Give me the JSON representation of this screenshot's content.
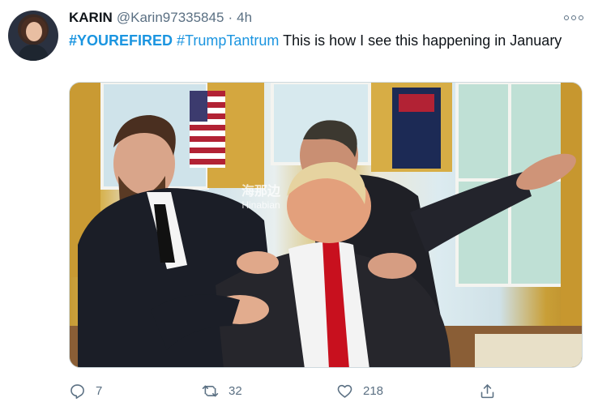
{
  "tweet": {
    "author_name": "KARIN",
    "author_handle": "@Karin97335845",
    "separator": "·",
    "time": "4h",
    "text": {
      "hashtag1": "#YOUREFIRED",
      "hashtag2": "#TrumpTantrum",
      "body": "This is how I see this happening in January"
    },
    "media": {
      "watermark_main": "海那边",
      "watermark_sub": "Hinabian"
    },
    "actions": {
      "reply_count": "7",
      "retweet_count": "32",
      "like_count": "218"
    }
  },
  "icons": {
    "more": "more-horizontal-icon",
    "reply": "reply-icon",
    "retweet": "retweet-icon",
    "like": "heart-icon",
    "share": "share-icon"
  },
  "colors": {
    "hashtag": "#1b95e0",
    "secondary_text": "#5b7083",
    "primary_text": "#0f1419",
    "tie": "#c8101e"
  }
}
